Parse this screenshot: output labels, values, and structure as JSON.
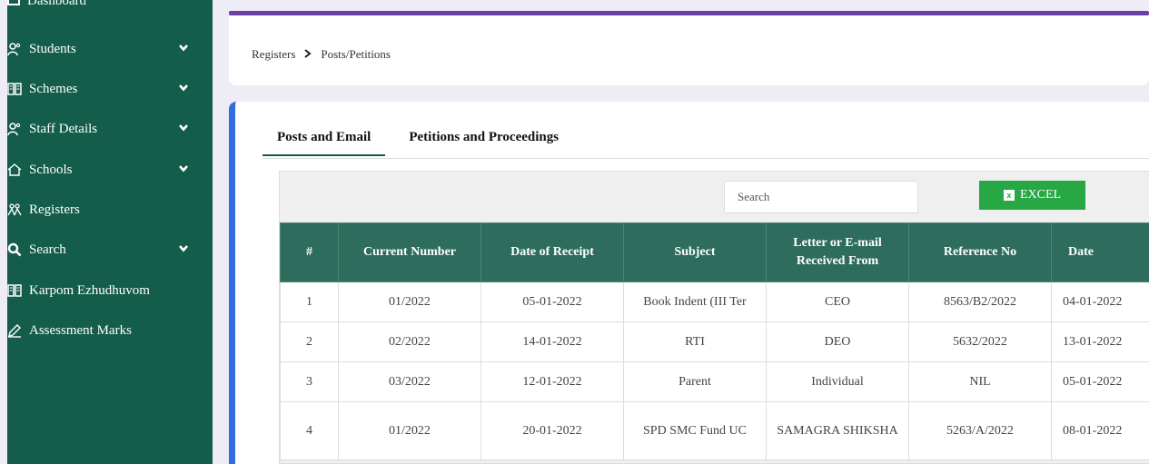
{
  "sidebar": {
    "top_label": "Dashboard",
    "items": [
      {
        "label": "Students",
        "icon": "users-icon",
        "has_chevron": true
      },
      {
        "label": "Schemes",
        "icon": "book-icon",
        "has_chevron": true
      },
      {
        "label": "Staff Details",
        "icon": "users-icon",
        "has_chevron": true
      },
      {
        "label": "Schools",
        "icon": "home-icon",
        "has_chevron": true
      },
      {
        "label": "Registers",
        "icon": "people-icon",
        "has_chevron": false
      },
      {
        "label": "Search",
        "icon": "search-icon",
        "has_chevron": true
      },
      {
        "label": "Karpom Ezhudhuvom",
        "icon": "book-icon",
        "has_chevron": false
      },
      {
        "label": "Assessment Marks",
        "icon": "pencil-icon",
        "has_chevron": false
      }
    ]
  },
  "breadcrumb": {
    "parent": "Registers",
    "current": "Posts/Petitions"
  },
  "tabs": [
    {
      "label": "Posts and Email",
      "active": true
    },
    {
      "label": "Petitions and Proceedings",
      "active": false
    }
  ],
  "toolbar": {
    "search_placeholder": "Search",
    "excel_label": "EXCEL"
  },
  "table": {
    "columns": [
      "#",
      "Current Number",
      "Date of Receipt",
      "Subject",
      "Letter or E-mail Received From",
      "Reference No",
      "Date"
    ],
    "rows": [
      [
        "1",
        "01/2022",
        "05-01-2022",
        "Book Indent (III Ter",
        "CEO",
        "8563/B2/2022",
        "04-01-2022"
      ],
      [
        "2",
        "02/2022",
        "14-01-2022",
        "RTI",
        "DEO",
        "5632/2022",
        "13-01-2022"
      ],
      [
        "3",
        "03/2022",
        "12-01-2022",
        "Parent",
        "Individual",
        "NIL",
        "05-01-2022"
      ],
      [
        "4",
        "01/2022",
        "20-01-2022",
        "SPD SMC Fund UC",
        "SAMAGRA SHIKSHA",
        "5263/A/2022",
        "08-01-2022"
      ]
    ]
  },
  "colors": {
    "sidebar": "#135d4a",
    "header": "#2e6d5d",
    "accent_bar": "#6b3fa6",
    "excel": "#28a745",
    "card_border": "#2f6de1"
  }
}
